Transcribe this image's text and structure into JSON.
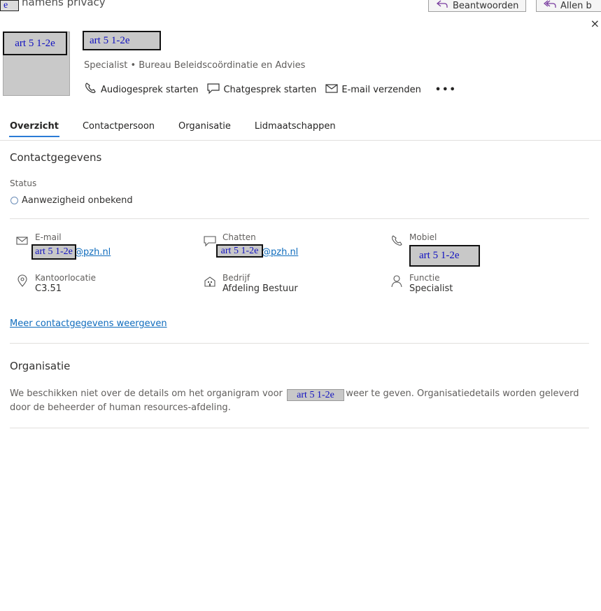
{
  "top": {
    "redaction_label": "e",
    "subject_fragment": "namens privacy",
    "reply_label": "Beantwoorden",
    "reply_all_label": "Allen b",
    "close_glyph": "×"
  },
  "profile": {
    "avatar_redaction": "art 5 1-2e",
    "name_redaction": "art 5 1-2e",
    "subtitle": "Specialist • Bureau Beleidscoördinatie en Advies",
    "actions": {
      "audio": "Audiogesprek starten",
      "chat": "Chatgesprek starten",
      "email": "E-mail verzenden",
      "more": "•••"
    }
  },
  "tabs": [
    {
      "label": "Overzicht",
      "active": true
    },
    {
      "label": "Contactpersoon",
      "active": false
    },
    {
      "label": "Organisatie",
      "active": false
    },
    {
      "label": "Lidmaatschappen",
      "active": false
    }
  ],
  "contact": {
    "title": "Contactgegevens",
    "status_label": "Status",
    "status_value": "Aanwezigheid onbekend",
    "email": {
      "label": "E-mail",
      "redaction": "art 5 1-2e",
      "suffix": "@pzh.nl"
    },
    "chat": {
      "label": "Chatten",
      "redaction": "art 5 1-2e",
      "suffix": "@pzh.nl"
    },
    "mobile": {
      "label": "Mobiel",
      "redaction": "art 5 1-2e"
    },
    "office": {
      "label": "Kantoorlocatie",
      "value": "C3.51"
    },
    "company": {
      "label": "Bedrijf",
      "value": "Afdeling Bestuur"
    },
    "function": {
      "label": "Functie",
      "value": "Specialist"
    },
    "more_link": "Meer contactgegevens weergeven"
  },
  "organisation": {
    "title": "Organisatie",
    "text_before": "We beschikken niet over de details om het organigram voor",
    "redaction": "art 5 1-2e",
    "text_after": "weer te geven. Organisatiedetails worden geleverd",
    "text_line2": "door de beheerder of human resources-afdeling."
  }
}
